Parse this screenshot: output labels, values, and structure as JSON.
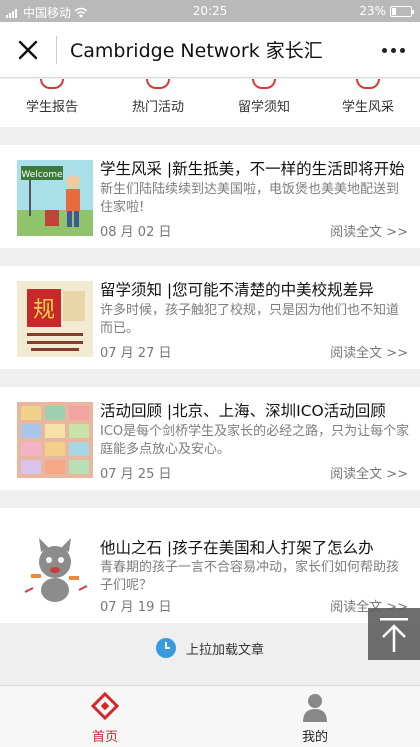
{
  "status_bar": {
    "carrier": "中国移动",
    "time": "20:25",
    "battery_percent": "23%",
    "battery_level": 0.23
  },
  "navbar": {
    "title": "Cambridge Network 家长汇"
  },
  "categories": [
    {
      "label": "学生报告",
      "icon": "report-icon"
    },
    {
      "label": "热门活动",
      "icon": "activity-icon"
    },
    {
      "label": "留学须知",
      "icon": "notice-icon"
    },
    {
      "label": "学生风采",
      "icon": "student-style-icon"
    }
  ],
  "articles": [
    {
      "title": "学生风采 |新生抵美，不一样的生活即将开始",
      "summary": "新生们陆陆续续到达美国啦，电饭煲也美美地配送到住家啦!",
      "date": "08 月 02 日",
      "read_more": "阅读全文 >>",
      "thumb_text": "Welcome"
    },
    {
      "title": "留学须知 |您可能不清楚的中美校规差异",
      "summary": "许多时候，孩子触犯了校规，只是因为他们也不知道而已。",
      "date": "07 月 27 日",
      "read_more": "阅读全文 >>",
      "thumb_text": "规"
    },
    {
      "title": "活动回顾 |北京、上海、深圳ICO活动回顾",
      "summary": "ICO是每个剑桥学生及家长的必经之路，只为让每个家庭能多点放心及安心。",
      "date": "07 月 25 日",
      "read_more": "阅读全文 >>",
      "thumb_text": ""
    },
    {
      "title": "他山之石 |孩子在美国和人打架了怎么办",
      "summary": "青春期的孩子一言不合容易冲动，家长们如何帮助孩子们呢？",
      "date": "07 月 19 日",
      "read_more": "阅读全文 >>",
      "thumb_text": ""
    }
  ],
  "load_more": "上拉加载文章",
  "tabs": [
    {
      "label": "首页",
      "active": true
    },
    {
      "label": "我的",
      "active": false
    }
  ],
  "colors": {
    "accent": "#d6262a",
    "status_bar": "#b9b9b9",
    "page_bg": "#efefef"
  }
}
